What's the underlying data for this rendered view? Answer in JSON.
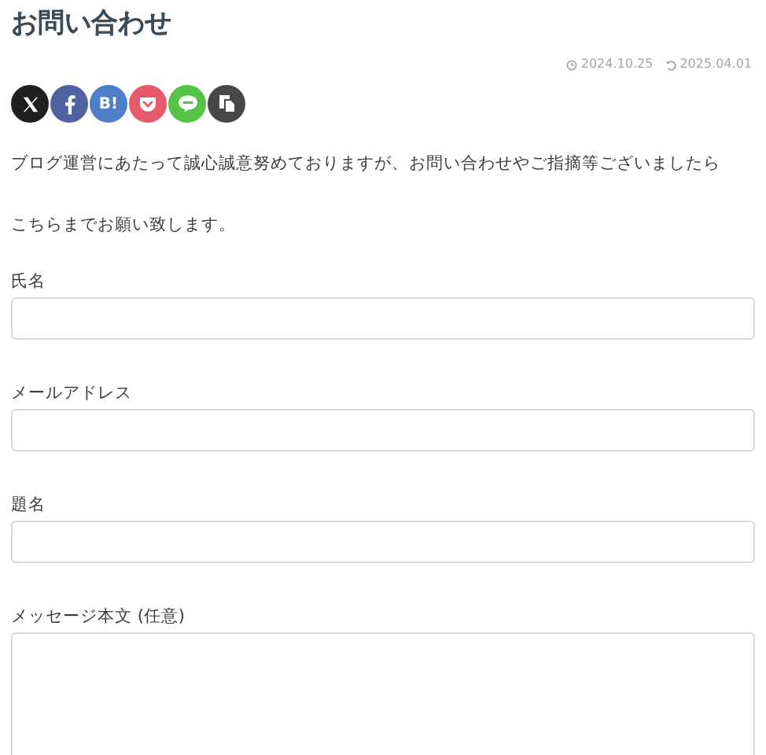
{
  "title": "お問い合わせ",
  "dates": {
    "published": "2024.10.25",
    "updated": "2025.04.01"
  },
  "share_buttons": [
    {
      "kind": "x",
      "color": "#1f1f1f"
    },
    {
      "kind": "facebook",
      "color": "#4f62a0"
    },
    {
      "kind": "hatena",
      "color": "#4e7fc9",
      "label": "B!"
    },
    {
      "kind": "pocket",
      "color": "#e5596a"
    },
    {
      "kind": "line",
      "color": "#55c346"
    },
    {
      "kind": "copy",
      "color": "#474747"
    }
  ],
  "intro": [
    "ブログ運営にあたって誠心誠意努めておりますが、お問い合わせやご指摘等ございましたら",
    "こちらまでお願い致します。"
  ],
  "fields": [
    {
      "label": "氏名",
      "kind": "input"
    },
    {
      "label": "メールアドレス",
      "kind": "input"
    },
    {
      "label": "題名",
      "kind": "input"
    },
    {
      "label": "メッセージ本文 (任意)",
      "kind": "textarea"
    }
  ]
}
